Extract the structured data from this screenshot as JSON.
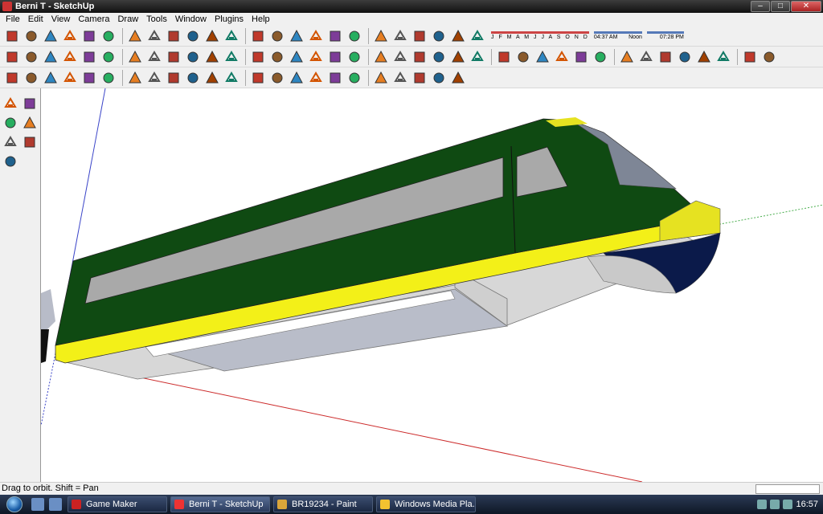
{
  "window": {
    "title": "Berni T - SketchUp",
    "buttons": {
      "minimize": "‒",
      "maximize": "□",
      "close": "✕"
    }
  },
  "menubar": {
    "items": [
      "File",
      "Edit",
      "View",
      "Camera",
      "Draw",
      "Tools",
      "Window",
      "Plugins",
      "Help"
    ]
  },
  "shadow_settings": {
    "months": "J F M A M J J A S O N D",
    "time_start": "04:37 AM",
    "time_mid": "Noon",
    "time_end": "07:28 PM"
  },
  "toolbar_icons": {
    "row1": [
      "select-icon",
      "pencil-icon",
      "rectangle-icon",
      "circle-icon",
      "arc-icon",
      "make-component-icon",
      "eraser-icon",
      "tape-measure-icon",
      "paint-bucket-icon",
      "push-pull-icon",
      "move-icon",
      "rotate-icon",
      "follow-me-icon",
      "orbit-icon",
      "pan-icon",
      "zoom-icon",
      "zoom-extents-icon",
      "google-earth-icon",
      "get-models-icon",
      "share-model-icon",
      "components-icon",
      "materials-icon",
      "shadows-icon",
      "fog-icon"
    ],
    "row2": [
      "iso-view-icon",
      "top-view-icon",
      "front-view-icon",
      "right-view-icon",
      "back-view-icon",
      "left-view-icon",
      "select-icon",
      "make-component-icon",
      "paint-bucket-icon",
      "eraser-icon",
      "rectangle-icon",
      "line-icon",
      "circle-icon",
      "arc-icon",
      "polygon-icon",
      "freehand-icon",
      "move-icon",
      "push-pull-icon",
      "rotate-icon",
      "follow-me-icon",
      "scale-icon",
      "offset-icon",
      "tape-measure-icon",
      "dimension-icon",
      "protractor-icon",
      "text-icon",
      "axes-icon",
      "3d-text-icon",
      "orbit-icon",
      "pan-icon",
      "zoom-icon",
      "zoom-window-icon",
      "previous-view-icon",
      "next-view-icon",
      "position-camera-icon",
      "look-around-icon",
      "walk-icon",
      "section-plane-icon"
    ],
    "row3": [
      "xray-icon",
      "back-edges-icon",
      "wireframe-icon",
      "hidden-line-icon",
      "rotate-tool-icon",
      "line-tool-icon",
      "refresh-icon",
      "edit-icon",
      "sandbox-icon",
      "smoove-icon",
      "stamp-icon",
      "drape-icon",
      "add-detail-icon",
      "flip-edge-icon",
      "box-icon",
      "cylinder-icon",
      "tube-icon",
      "cone-icon",
      "pill-icon",
      "slab-icon",
      "torus-icon",
      "stair-icon",
      "dome-icon"
    ],
    "left": [
      "orbit-icon",
      "pan-icon",
      "zoom-icon",
      "zoom-window-icon",
      "zoom-extents-icon",
      "previous-icon",
      "zoom-all-icon"
    ]
  },
  "colors": {
    "train_green": "#0f4a12",
    "train_yellow": "#f3f018",
    "window_grey": "#a9a9a9",
    "underframe_grey": "#d7d7d7",
    "red_axis": "#cc2b2b",
    "blue_axis": "#3a44c8",
    "green_axis": "#4caf50"
  },
  "status": {
    "hint": "Drag to orbit.  Shift = Pan"
  },
  "taskbar": {
    "tasks": [
      "Game Maker",
      "Berni T - SketchUp",
      "BR19234 - Paint",
      "Windows Media Pla..."
    ],
    "clock": "16:57"
  }
}
